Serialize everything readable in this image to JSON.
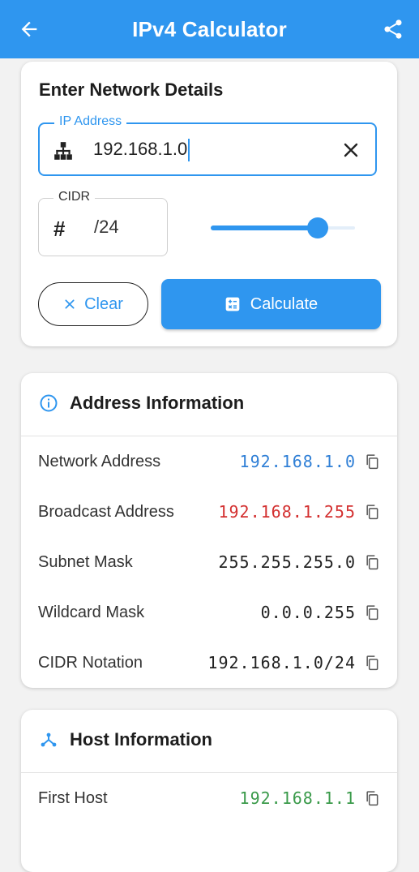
{
  "appbar": {
    "title": "IPv4 Calculator",
    "back_icon": "arrow-back-icon",
    "share_icon": "share-icon",
    "color": "#2f96ef"
  },
  "network_details": {
    "title": "Enter Network Details",
    "ip_field": {
      "label": "IP Address",
      "value": "192.168.1.0"
    },
    "cidr_field": {
      "label": "CIDR",
      "value": "/24"
    },
    "slider": {
      "value": 24,
      "min": 0,
      "max": 32
    },
    "clear_button": {
      "label": "Clear"
    },
    "calculate_button": {
      "label": "Calculate"
    }
  },
  "address_info": {
    "title": "Address Information",
    "rows": [
      {
        "label": "Network Address",
        "value": "192.168.1.0",
        "color": "#2f7fd6"
      },
      {
        "label": "Broadcast Address",
        "value": "192.168.1.255",
        "color": "#d32f2f"
      },
      {
        "label": "Subnet Mask",
        "value": "255.255.255.0",
        "color": "#222222"
      },
      {
        "label": "Wildcard Mask",
        "value": "0.0.0.255",
        "color": "#222222"
      },
      {
        "label": "CIDR Notation",
        "value": "192.168.1.0/24",
        "color": "#222222"
      }
    ]
  },
  "host_info": {
    "title": "Host Information",
    "rows": [
      {
        "label": "First Host",
        "value": "192.168.1.1",
        "color": "#3a9a4a"
      }
    ]
  }
}
